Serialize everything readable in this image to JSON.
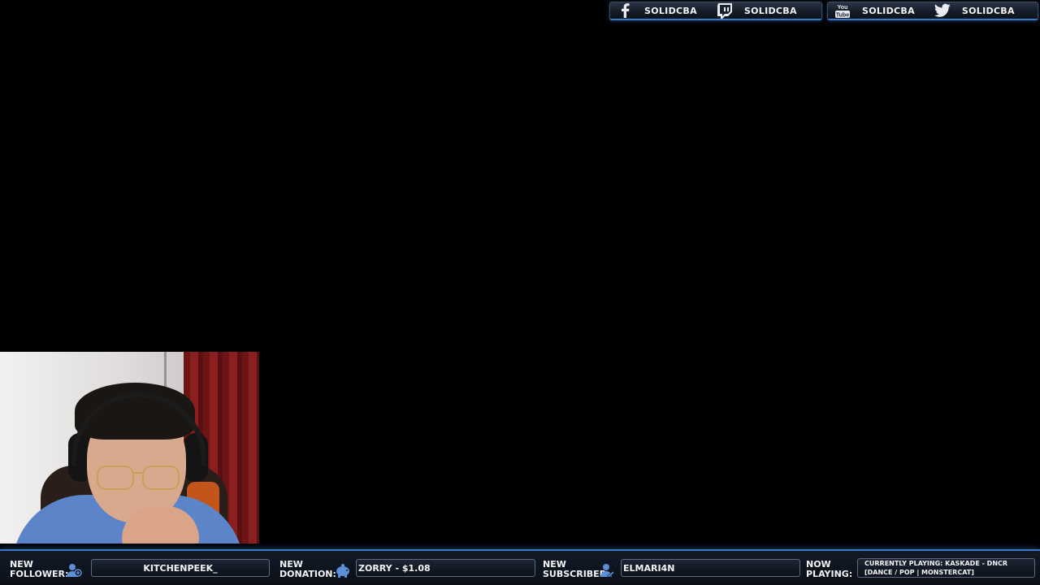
{
  "social": [
    {
      "icon": "facebook-icon",
      "label": "SOLIDCBA"
    },
    {
      "icon": "twitch-icon",
      "label": "SOLIDCBA"
    },
    {
      "icon": "youtube-icon",
      "label": "SOLIDCBA"
    },
    {
      "icon": "twitter-icon",
      "label": "SOLIDCBA"
    }
  ],
  "youtube_icon_text": {
    "top": "You",
    "bottom": "Tube"
  },
  "alerts": {
    "follower": {
      "label_line1": "NEW",
      "label_line2": "FOLLOWER:",
      "icon": "user-add-icon",
      "value": "KITCHENPEEK_"
    },
    "donation": {
      "label_line1": "NEW",
      "label_line2": "DONATION:",
      "icon": "piggy-bank-icon",
      "value": "ZORRY - $1.08"
    },
    "subscriber": {
      "label_line1": "NEW",
      "label_line2": "SUBSCRIBER:",
      "icon": "user-check-icon",
      "value": "ELMARI4N"
    },
    "now_playing": {
      "label_line1": "NOW",
      "label_line2": "PLAYING:",
      "value": "CURRENTLY PLAYING: KASKADE - DNCR [DANCE / POP | MONSTERCAT]"
    }
  },
  "colors": {
    "accent": "#3a78c9",
    "text": "#f2f4f7",
    "background": "#000000",
    "icon": "#5b8fd6"
  }
}
